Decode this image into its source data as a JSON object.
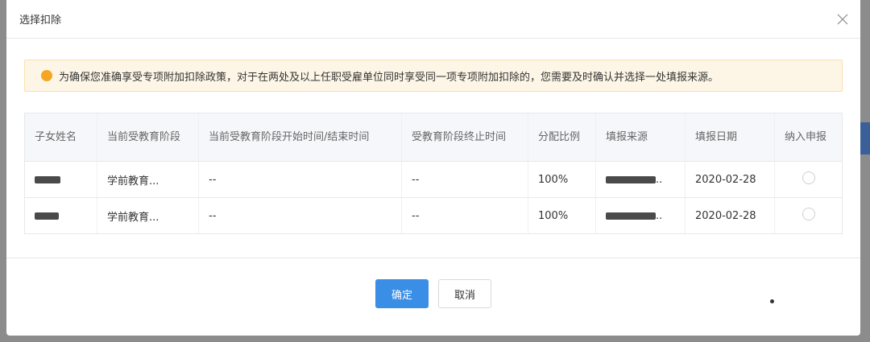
{
  "dialog": {
    "title": "选择扣除",
    "notice": "为确保您准确享受专项附加扣除政策，对于在两处及以上任职受雇单位同时享受同一项专项附加扣除的，您需要及时确认并选择一处填报来源。"
  },
  "table": {
    "headers": [
      "子女姓名",
      "当前受教育阶段",
      "当前受教育阶段开始时间/结束时间",
      "受教育阶段终止时间",
      "分配比例",
      "填报来源",
      "填报日期",
      "纳入申报"
    ],
    "rows": [
      {
        "name": "",
        "stage": "学前教育...",
        "start_end": "--",
        "end_time": "--",
        "ratio": "100%",
        "source_suffix": "..",
        "date": "2020-02-28"
      },
      {
        "name": "",
        "stage": "学前教育...",
        "start_end": "--",
        "end_time": "--",
        "ratio": "100%",
        "source_suffix": "..",
        "date": "2020-02-28"
      }
    ]
  },
  "buttons": {
    "ok": "确定",
    "cancel": "取消"
  },
  "icons": {
    "close": "close-icon",
    "warning": "warning-icon"
  },
  "colors": {
    "primary": "#3a8ee6",
    "warning": "#f5a623",
    "notice_bg": "#fdf6e7"
  }
}
